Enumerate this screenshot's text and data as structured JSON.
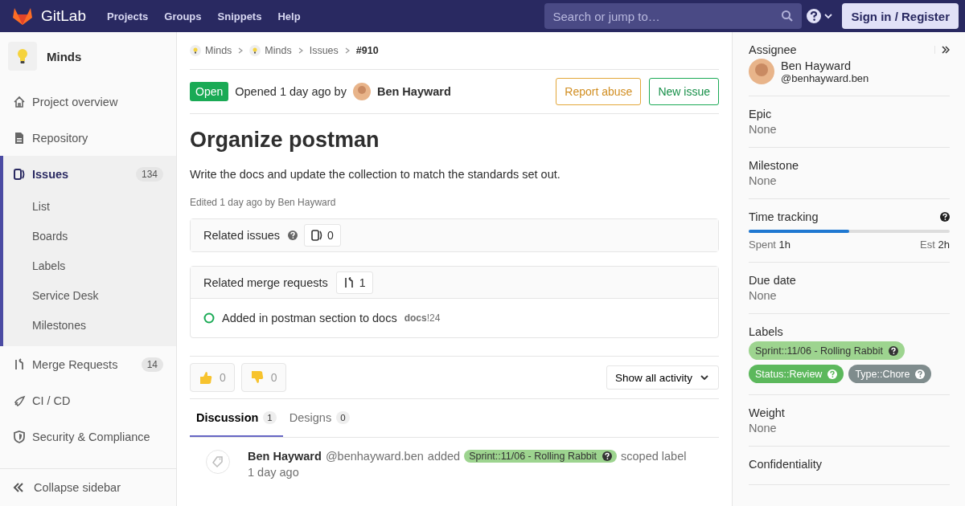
{
  "header": {
    "logo": "GitLab",
    "nav": [
      "Projects",
      "Groups",
      "Snippets",
      "Help"
    ],
    "search": {
      "placeholder": "Search or jump to…"
    },
    "sign_in": "Sign in / Register"
  },
  "sidebar": {
    "project": "Minds",
    "items": [
      {
        "label": "Project overview",
        "selected": false
      },
      {
        "label": "Repository",
        "selected": false
      },
      {
        "label": "Issues",
        "count": "134",
        "selected": true,
        "children": [
          {
            "label": "List"
          },
          {
            "label": "Boards"
          },
          {
            "label": "Labels"
          },
          {
            "label": "Service Desk"
          },
          {
            "label": "Milestones"
          }
        ]
      },
      {
        "label": "Merge Requests",
        "count": "14",
        "selected": false
      },
      {
        "label": "CI / CD",
        "selected": false
      },
      {
        "label": "Security & Compliance",
        "selected": false
      }
    ],
    "collapse": "Collapse sidebar"
  },
  "breadcrumbs": [
    {
      "label": "Minds",
      "kind": "avatar"
    },
    {
      "label": "Minds",
      "kind": "avatar"
    },
    {
      "label": "Issues",
      "kind": "link"
    },
    {
      "label": "#910",
      "kind": "current"
    }
  ],
  "issue": {
    "status": "Open",
    "opened": "Opened 1 day ago by",
    "author": "Ben Hayward",
    "actions": [
      {
        "label": "Report abuse",
        "kind": "warning"
      },
      {
        "label": "New issue",
        "kind": "success"
      }
    ],
    "title": "Organize postman",
    "description": "Write the docs and update the collection to match the standards set out.",
    "edited": "Edited 1 day ago by Ben Hayward"
  },
  "related_issues": {
    "title": "Related issues",
    "count": "0"
  },
  "related_merge_requests": {
    "title": "Related merge requests",
    "count": "1",
    "items": [
      {
        "title": "Added in postman section to docs",
        "project": "docs",
        "ref": "!24"
      }
    ]
  },
  "awards": [
    {
      "kind": "thumbsup",
      "count": "0"
    },
    {
      "kind": "thumbsdown",
      "count": "0"
    }
  ],
  "activity_filter": "Show all activity",
  "tabs": [
    {
      "label": "Discussion",
      "count": "1",
      "selected": true
    },
    {
      "label": "Designs",
      "count": "0",
      "selected": false
    }
  ],
  "notes": [
    {
      "author": "Ben Hayward",
      "handle": "@benhayward.ben",
      "action": "added",
      "label": {
        "text": "Sprint::11/06 - Rolling Rabbit",
        "color": "#9dd48f"
      },
      "suffix": "scoped label",
      "time": "1 day ago"
    }
  ],
  "right_sidebar": {
    "sections": [
      {
        "kind": "assignee",
        "title": "Assignee",
        "name": "Ben Hayward",
        "handle": "@benhayward.ben"
      },
      {
        "kind": "value",
        "title": "Epic",
        "value": "None"
      },
      {
        "kind": "value",
        "title": "Milestone",
        "value": "None"
      },
      {
        "kind": "time",
        "title": "Time tracking",
        "level": 0.5,
        "spent_label": "Spent",
        "spent": "1h",
        "est_label": "Est",
        "est": "2h"
      },
      {
        "kind": "value",
        "title": "Due date",
        "value": "None"
      },
      {
        "kind": "labels",
        "title": "Labels",
        "labels": [
          {
            "text": "Sprint::11/06 - Rolling Rabbit",
            "color": "#9dd48f"
          },
          {
            "text": "Status::Review",
            "color": "#5cb85c"
          },
          {
            "text": "Type::Chore",
            "color": "#7f8c8d"
          }
        ]
      },
      {
        "kind": "value",
        "title": "Weight",
        "value": "None"
      },
      {
        "kind": "heading",
        "title": "Confidentiality"
      }
    ]
  }
}
